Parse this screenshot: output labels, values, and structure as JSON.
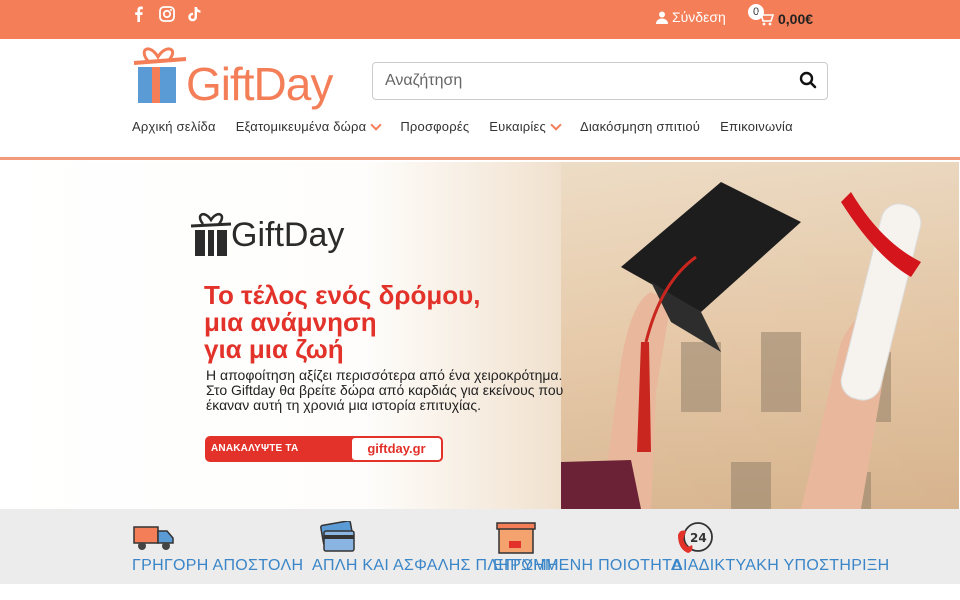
{
  "topbar": {
    "social": [
      "facebook-icon",
      "instagram-icon",
      "tiktok-icon"
    ],
    "login_label": "Σύνδεση",
    "cart_count": "0",
    "cart_total": "0,00€"
  },
  "header": {
    "logo_text": "GiftDay",
    "search_placeholder": "Αναζήτηση",
    "nav": [
      {
        "label": "Αρχική σελίδα"
      },
      {
        "label": "Εξατομικευμένα δώρα"
      },
      {
        "label": "Προσφορές"
      },
      {
        "label": "Ευκαιρίες"
      },
      {
        "label": "Διακόσμηση σπιτιού"
      },
      {
        "label": "Επικοινωνία"
      }
    ]
  },
  "hero": {
    "logo_text": "GiftDay",
    "title_line1": "Το τέλος ενός δρόμου,",
    "title_line2": "μια ανάμνηση",
    "title_line3": "για μια ζωή",
    "body_line1": "Η αποφοίτηση αξίζει περισσότερα από ένα χειροκρότημα.",
    "body_line2": "Στο Giftday θα βρείτε δώρα από καρδιάς για εκείνους που",
    "body_line3": "έκαναν αυτή τη χρονιά μια ιστορία επιτυχίας.",
    "cta_label": "ΑΝΑΚΑΛΥΨΤΕ ΤΑ ΠΡΟΪΟΝΤΑ",
    "cta_domain": "giftday.gr"
  },
  "features": [
    {
      "icon": "truck-icon",
      "label": "ΓΡΗΓΟΡΗ ΑΠΟΣΤΟΛΗ"
    },
    {
      "icon": "credit-card-icon",
      "label": "ΑΠΛΗ ΚΑΙ ΑΣΦΑΛΗΣ ΠΛΗΡΩΜΗ"
    },
    {
      "icon": "box-icon",
      "label": "ΕΓΓΥΗΜΕΝΗ ΠΟΙΟΤΗΤΑ"
    },
    {
      "icon": "support-24-icon",
      "label": "ΔΙΑΔΙΚΤΥΑΚΗ ΥΠΟΣΤΗΡΙΞΗ"
    }
  ],
  "colors": {
    "brand_orange": "#f47e57",
    "hero_red": "#e2322a",
    "feature_blue": "#3a86c8"
  }
}
